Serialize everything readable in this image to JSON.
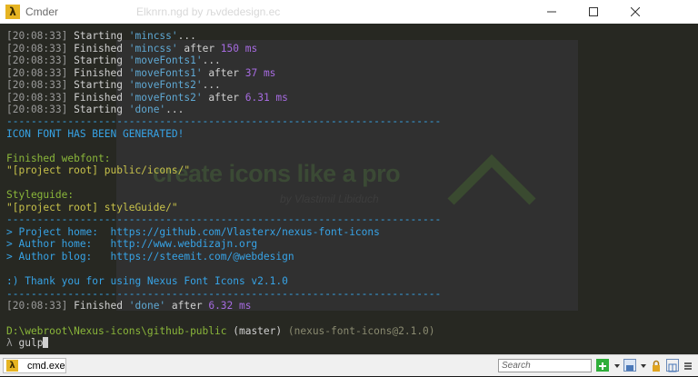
{
  "window": {
    "title": "Cmder",
    "ghost_title": "Elknrn.ngd by љvdedesign.ec"
  },
  "background_art": {
    "headline": "create icons like a pro",
    "byline": "by Vlastimil Libiduch"
  },
  "terminal": {
    "log": [
      {
        "time": "[20:08:33]",
        "verb": "Starting",
        "task": "'mincss'",
        "suffix": "...",
        "ms": ""
      },
      {
        "time": "[20:08:33]",
        "verb": "Finished",
        "task": "'mincss'",
        "suffix": " after ",
        "ms": "150 ms"
      },
      {
        "time": "[20:08:33]",
        "verb": "Starting",
        "task": "'moveFonts1'",
        "suffix": "...",
        "ms": ""
      },
      {
        "time": "[20:08:33]",
        "verb": "Finished",
        "task": "'moveFonts1'",
        "suffix": " after ",
        "ms": "37 ms"
      },
      {
        "time": "[20:08:33]",
        "verb": "Starting",
        "task": "'moveFonts2'",
        "suffix": "...",
        "ms": ""
      },
      {
        "time": "[20:08:33]",
        "verb": "Finished",
        "task": "'moveFonts2'",
        "suffix": " after ",
        "ms": "6.31 ms"
      },
      {
        "time": "[20:08:33]",
        "verb": "Starting",
        "task": "'done'",
        "suffix": "...",
        "ms": ""
      }
    ],
    "separator": "-----------------------------------------------------------------------",
    "generated": "ICON FONT HAS BEEN GENERATED!",
    "webfont_label": "Finished webfont:",
    "webfont_path": "\"[project root] public/icons/\"",
    "styleguide_label": "Styleguide:",
    "styleguide_path": "\"[project root] styleGuide/\"",
    "links": [
      {
        "label": "> Project home:  ",
        "url": "https://github.com/Vlasterx/nexus-font-icons"
      },
      {
        "label": "> Author home:   ",
        "url": "http://www.webdizajn.org"
      },
      {
        "label": "> Author blog:   ",
        "url": "https://steemit.com/@webdesign"
      }
    ],
    "thanks": ":) Thank you for using Nexus Font Icons v2.1.0",
    "final": {
      "time": "[20:08:33]",
      "verb": "Finished",
      "task": "'done'",
      "suffix": " after ",
      "ms": "6.32 ms"
    },
    "prompt": {
      "path": "D:\\webroot\\Nexus-icons\\github-public",
      "branch": "(master)",
      "package": "(nexus-font-icons@2.1.0)",
      "symbol": "λ",
      "command": "gulp"
    }
  },
  "statusbar": {
    "tab_label": "cmd.exe",
    "search_placeholder": "Search"
  },
  "colors": {
    "terminal_bg": "#272822",
    "time": "#9a9a9a",
    "task": "#5fa8d3",
    "duration": "#a66be0",
    "headline": "#37a3e6",
    "path": "#c8c24a",
    "prompt_path": "#8ab63a"
  }
}
